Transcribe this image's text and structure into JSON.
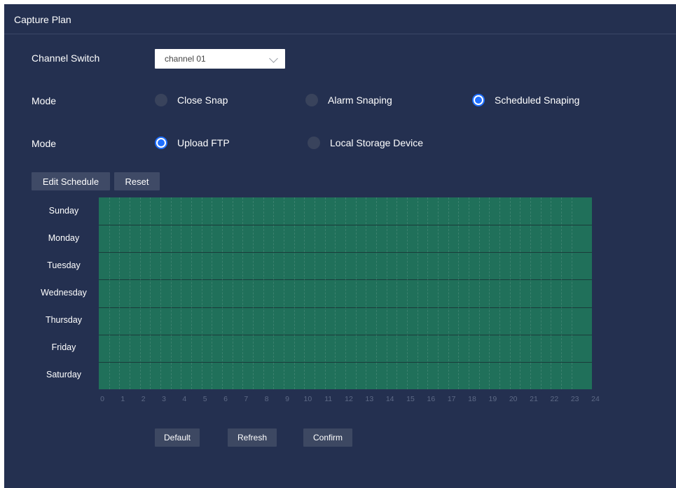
{
  "panel": {
    "title": "Capture Plan"
  },
  "channel": {
    "label": "Channel Switch",
    "value": "channel 01"
  },
  "mode1": {
    "label": "Mode",
    "options": [
      {
        "label": "Close Snap",
        "selected": false
      },
      {
        "label": "Alarm Snaping",
        "selected": false
      },
      {
        "label": "Scheduled Snaping",
        "selected": true
      }
    ]
  },
  "mode2": {
    "label": "Mode",
    "options": [
      {
        "label": "Upload FTP",
        "selected": true
      },
      {
        "label": "Local Storage Device",
        "selected": false
      }
    ]
  },
  "schedule": {
    "edit_label": "Edit Schedule",
    "reset_label": "Reset",
    "days": [
      "Sunday",
      "Monday",
      "Tuesday",
      "Wednesday",
      "Thursday",
      "Friday",
      "Saturday"
    ],
    "hours": [
      "0",
      "1",
      "2",
      "3",
      "4",
      "5",
      "6",
      "7",
      "8",
      "9",
      "10",
      "11",
      "12",
      "13",
      "14",
      "15",
      "16",
      "17",
      "18",
      "19",
      "20",
      "21",
      "22",
      "23",
      "24"
    ],
    "fill_color": "#20705a"
  },
  "footer": {
    "default_label": "Default",
    "refresh_label": "Refresh",
    "confirm_label": "Confirm"
  },
  "colors": {
    "background": "#243050",
    "accent": "#1f6fff",
    "button": "#3f4a66"
  }
}
